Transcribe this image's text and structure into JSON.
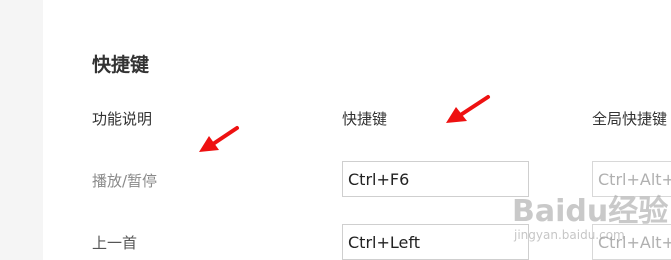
{
  "section_title": "快捷键",
  "columns": {
    "function": "功能说明",
    "hotkey": "快捷键",
    "global_hotkey": "全局快捷键"
  },
  "rows": [
    {
      "label": "播放/暂停",
      "hotkey": "Ctrl+F6",
      "global_hotkey": "Ctrl+Alt+"
    },
    {
      "label": "上一首",
      "hotkey": "Ctrl+Left",
      "global_hotkey": "Ctrl+Alt+"
    }
  ],
  "watermark": {
    "logo": "Baidu经验",
    "url": "jingyan.baidu.com"
  },
  "colors": {
    "annotation_arrow": "#ee1111",
    "sidebar": "#f5f5f5",
    "input_border": "#cfcfcf",
    "muted_text": "#8a8a8a"
  },
  "icons": [
    "red-arrow-annotation",
    "red-arrow-annotation"
  ]
}
